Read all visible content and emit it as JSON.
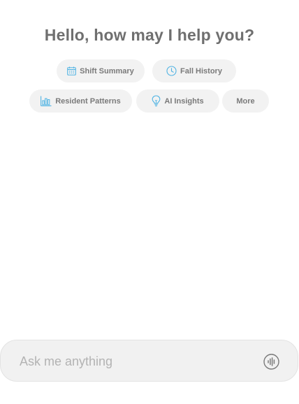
{
  "greeting": "Hello, how may I help you?",
  "chips": {
    "shift_summary": {
      "label": "Shift Summary",
      "icon": "calendar-icon"
    },
    "fall_history": {
      "label": "Fall History",
      "icon": "clock-icon"
    },
    "resident_patterns": {
      "label": "Resident Patterns",
      "icon": "bar-chart-icon"
    },
    "ai_insights": {
      "label": "AI Insights",
      "icon": "lightbulb-icon"
    },
    "more": {
      "label": "More"
    }
  },
  "composer": {
    "placeholder": "Ask me anything",
    "value": "",
    "voice_icon": "voice-waveform-icon"
  },
  "colors": {
    "icon_accent": "#4fb3e3",
    "chip_background": "#f2f2f2",
    "heading_text": "#6f6f6f",
    "chip_text": "#7a7a7a",
    "composer_background": "#f1f1f1",
    "placeholder_text": "#b3b3b3"
  }
}
